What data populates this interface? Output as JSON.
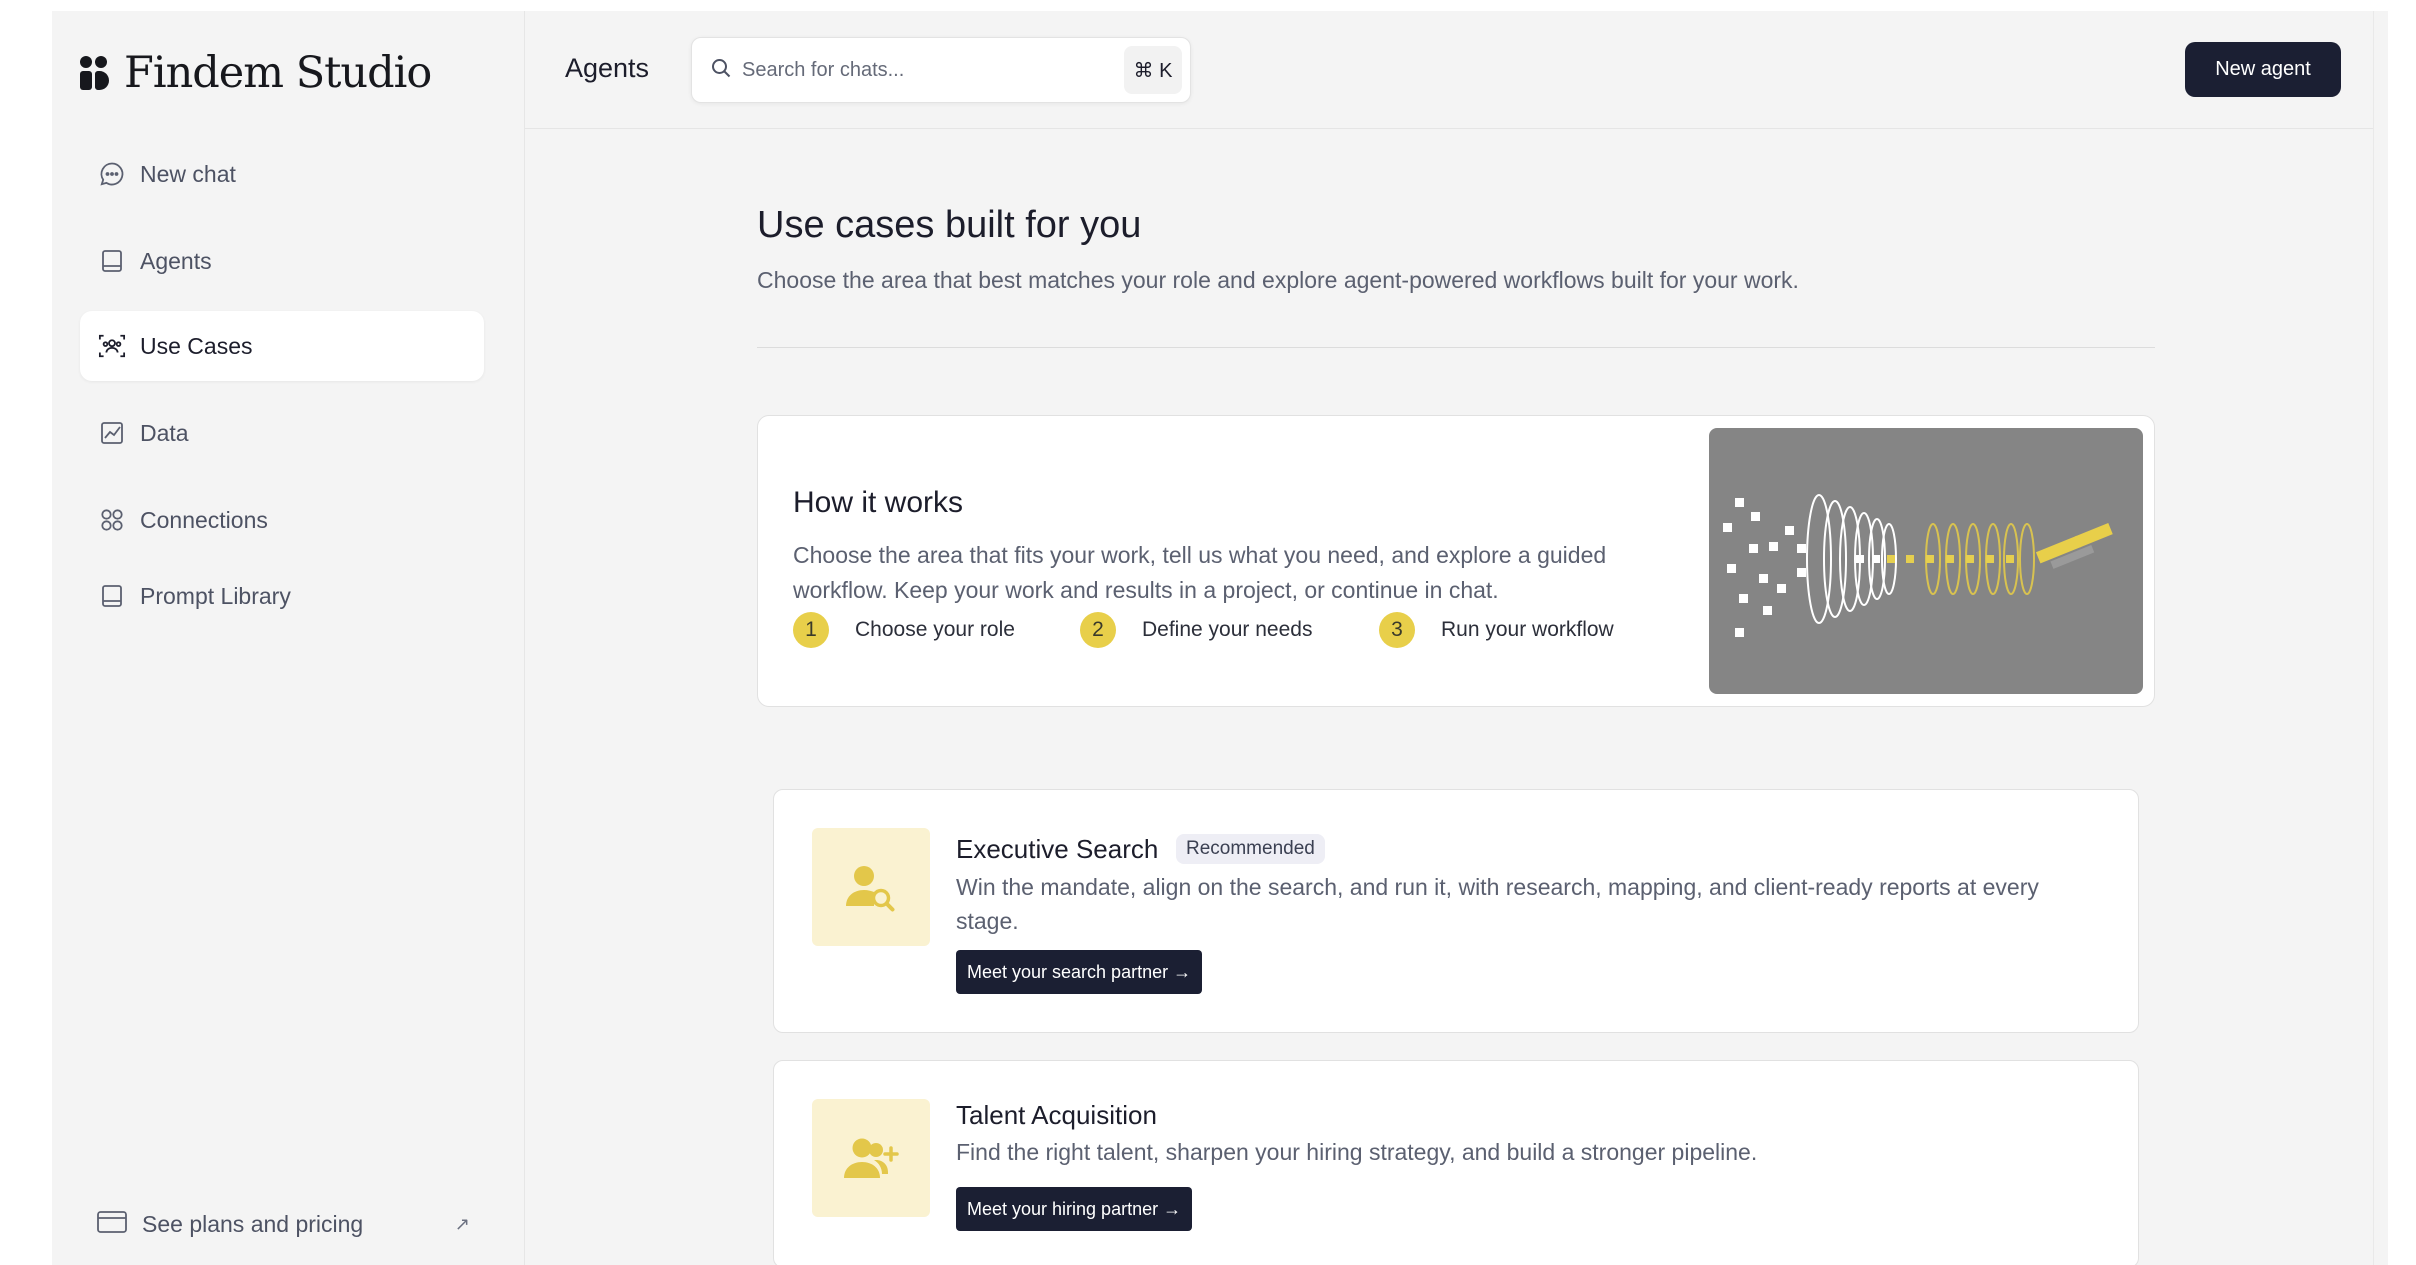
{
  "app": {
    "name": "Findem Studio"
  },
  "sidebar": {
    "items": [
      {
        "label": "New chat",
        "icon": "chat-bubble-icon"
      },
      {
        "label": "Agents",
        "icon": "book-icon"
      },
      {
        "label": "Use Cases",
        "icon": "users-scan-icon",
        "active": true
      },
      {
        "label": "Data",
        "icon": "chart-icon"
      },
      {
        "label": "Connections",
        "icon": "grid-circles-icon"
      },
      {
        "label": "Prompt Library",
        "icon": "library-icon"
      }
    ],
    "footer": {
      "label": "See plans and pricing",
      "icon": "credit-card-icon",
      "arrow": "↗"
    }
  },
  "header": {
    "title": "Agents",
    "search_placeholder": "Search for chats...",
    "shortcut": "⌘ K",
    "new_agent_label": "New agent"
  },
  "page": {
    "title": "Use cases built for you",
    "subtitle": "Choose the area that best matches your role and explore agent-powered workflows built for your work."
  },
  "how_it_works": {
    "title": "How it works",
    "description": "Choose the area that fits your work, tell us what you need, and explore a guided workflow. Keep your work and results in a project, or continue in chat.",
    "steps": [
      {
        "num": "1",
        "label": "Choose your role"
      },
      {
        "num": "2",
        "label": "Define your needs"
      },
      {
        "num": "3",
        "label": "Run your workflow"
      }
    ]
  },
  "use_cases": [
    {
      "title": "Executive Search",
      "badge": "Recommended",
      "description": "Win the mandate, align on the search, and run it, with research, mapping, and client-ready reports at every stage.",
      "button": "Meet your search partner →",
      "icon": "user-search-icon"
    },
    {
      "title": "Talent Acquisition",
      "description": "Find the right talent, sharpen your hiring strategy, and build a stronger pipeline.",
      "button": "Meet your hiring partner →",
      "icon": "user-plus-icon"
    }
  ],
  "colors": {
    "accent": "#e8cf4a",
    "dark": "#1b1f33",
    "icon_bg": "#faf2d1",
    "icon_fg": "#e3c74a"
  }
}
